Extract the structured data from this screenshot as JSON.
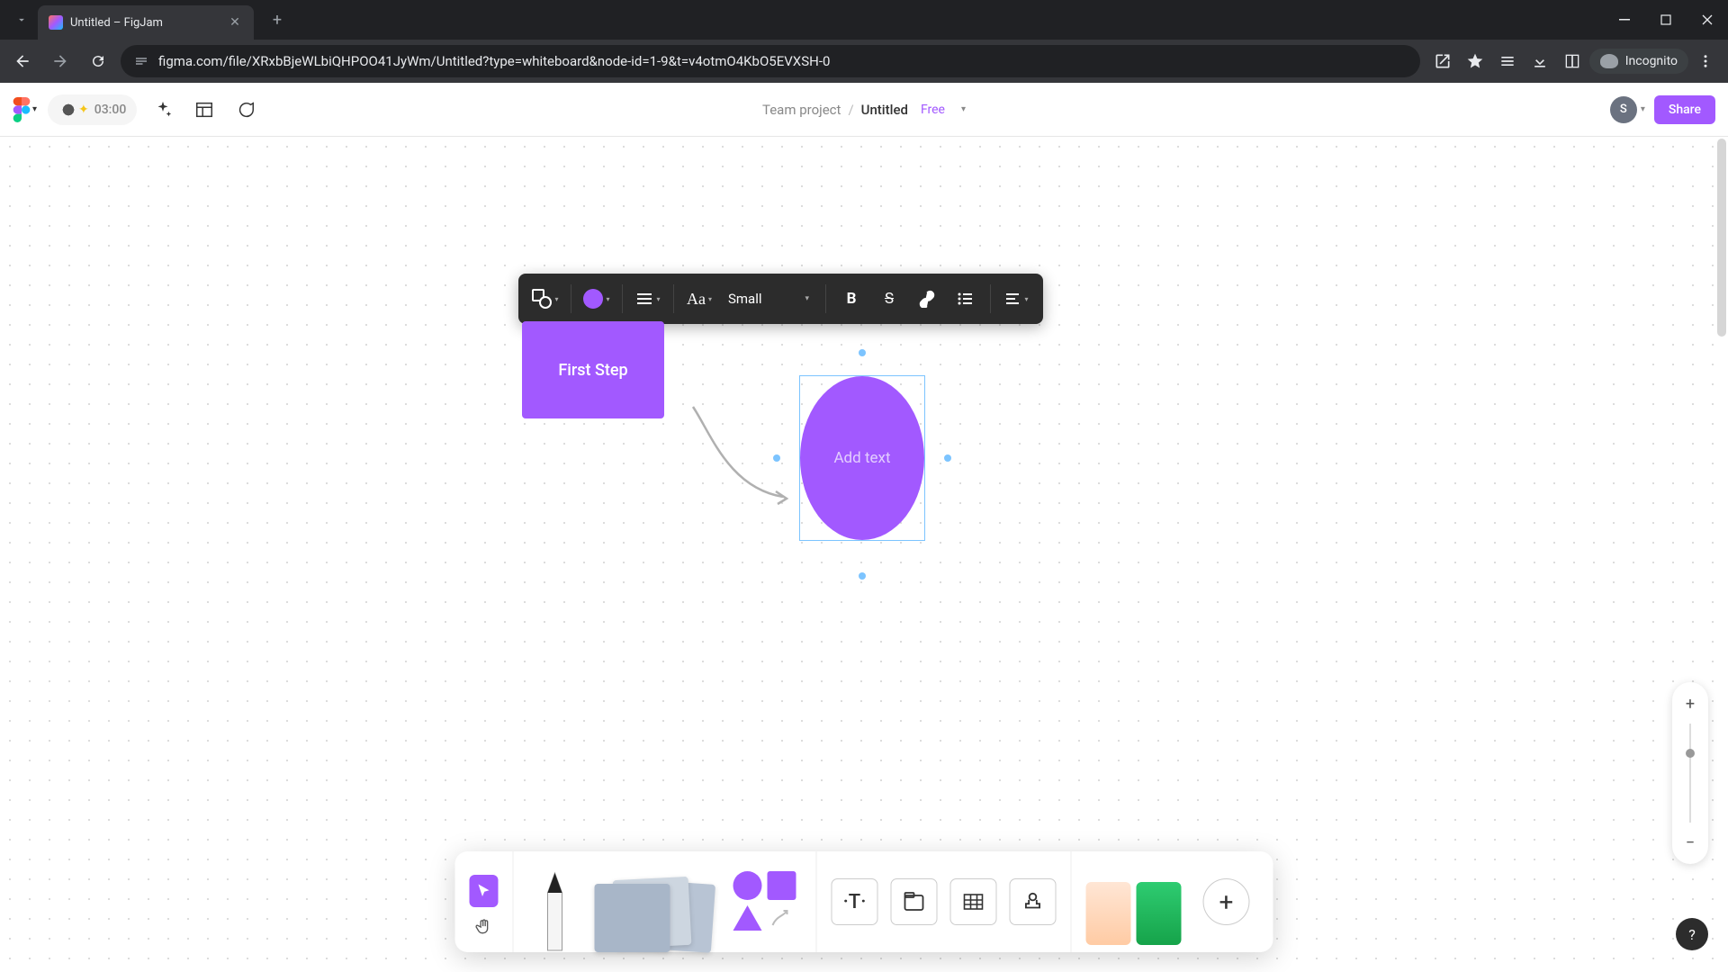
{
  "browser": {
    "tab_title": "Untitled – FigJam",
    "url": "figma.com/file/XRxbBjeWLbiQHPOO41JyWm/Untitled?type=whiteboard&node-id=1-9&t=v4otmO4KbO5EVXSH-0",
    "incognito_label": "Incognito"
  },
  "header": {
    "timer": "03:00",
    "breadcrumb_team": "Team project",
    "breadcrumb_sep": "/",
    "breadcrumb_title": "Untitled",
    "plan": "Free",
    "avatar_letter": "S",
    "share_label": "Share"
  },
  "context_toolbar": {
    "size_label": "Small",
    "bold": "B",
    "strike": "S"
  },
  "canvas": {
    "shape_rect_label": "First Step",
    "shape_ellipse_placeholder": "Add text"
  },
  "colors": {
    "purple": "#a259ff",
    "selection_blue": "#7cc4ff"
  }
}
